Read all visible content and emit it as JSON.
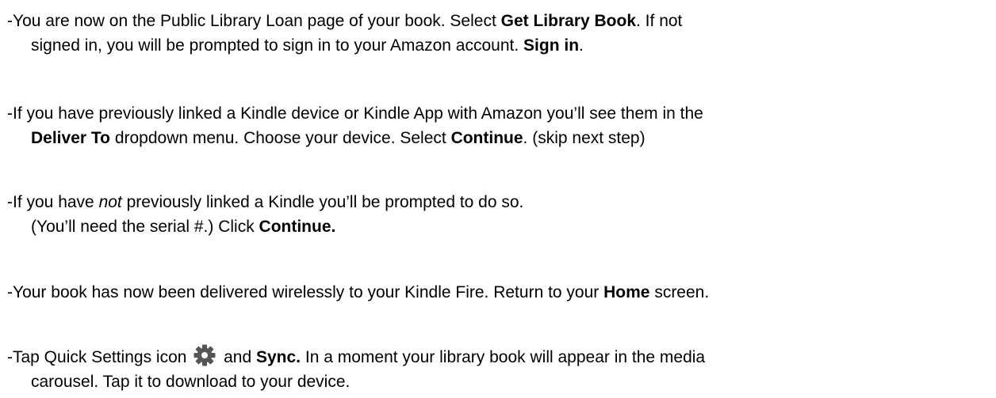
{
  "instructions": {
    "step1": {
      "line1_text_a": "-You are now on the Public Library Loan page of your book. Select ",
      "line1_bold_a": "Get Library Book",
      "line1_text_b": ". If not",
      "line2_text_a": "signed in, you will be prompted to sign in to your Amazon account. ",
      "line2_bold_a": "Sign in",
      "line2_text_b": "."
    },
    "step2": {
      "line1_text_a": "-If you have previously linked a Kindle device or Kindle App with Amazon you’ll see them in the",
      "line2_bold_a": "Deliver To",
      "line2_text_a": " dropdown menu. Choose your device. Select ",
      "line2_bold_b": "Continue",
      "line2_text_b": ". (skip next step)"
    },
    "step3": {
      "line1_text_a": "-If you have ",
      "line1_italic_a": "not",
      "line1_text_b": " previously linked a Kindle you’ll be  prompted to do so.",
      "line2_text_a": "(You’ll need the serial #.) Click ",
      "line2_bold_a": "Continue."
    },
    "step4": {
      "line1_text_a": "-Your book has now been delivered wirelessly to your Kindle Fire. Return to your ",
      "line1_bold_a": "Home",
      "line1_text_b": " screen."
    },
    "step5": {
      "line1_text_a": "-Tap Quick Settings  icon ",
      "icon": "gear-icon",
      "line1_text_b": " and ",
      "line1_bold_a": "Sync.",
      "line1_text_c": " In a moment your library book will appear in the media",
      "line2_text_a": "carousel.  Tap it to download to your device."
    }
  },
  "colors": {
    "text": "#000000",
    "background": "#ffffff",
    "icon": "#555555"
  }
}
